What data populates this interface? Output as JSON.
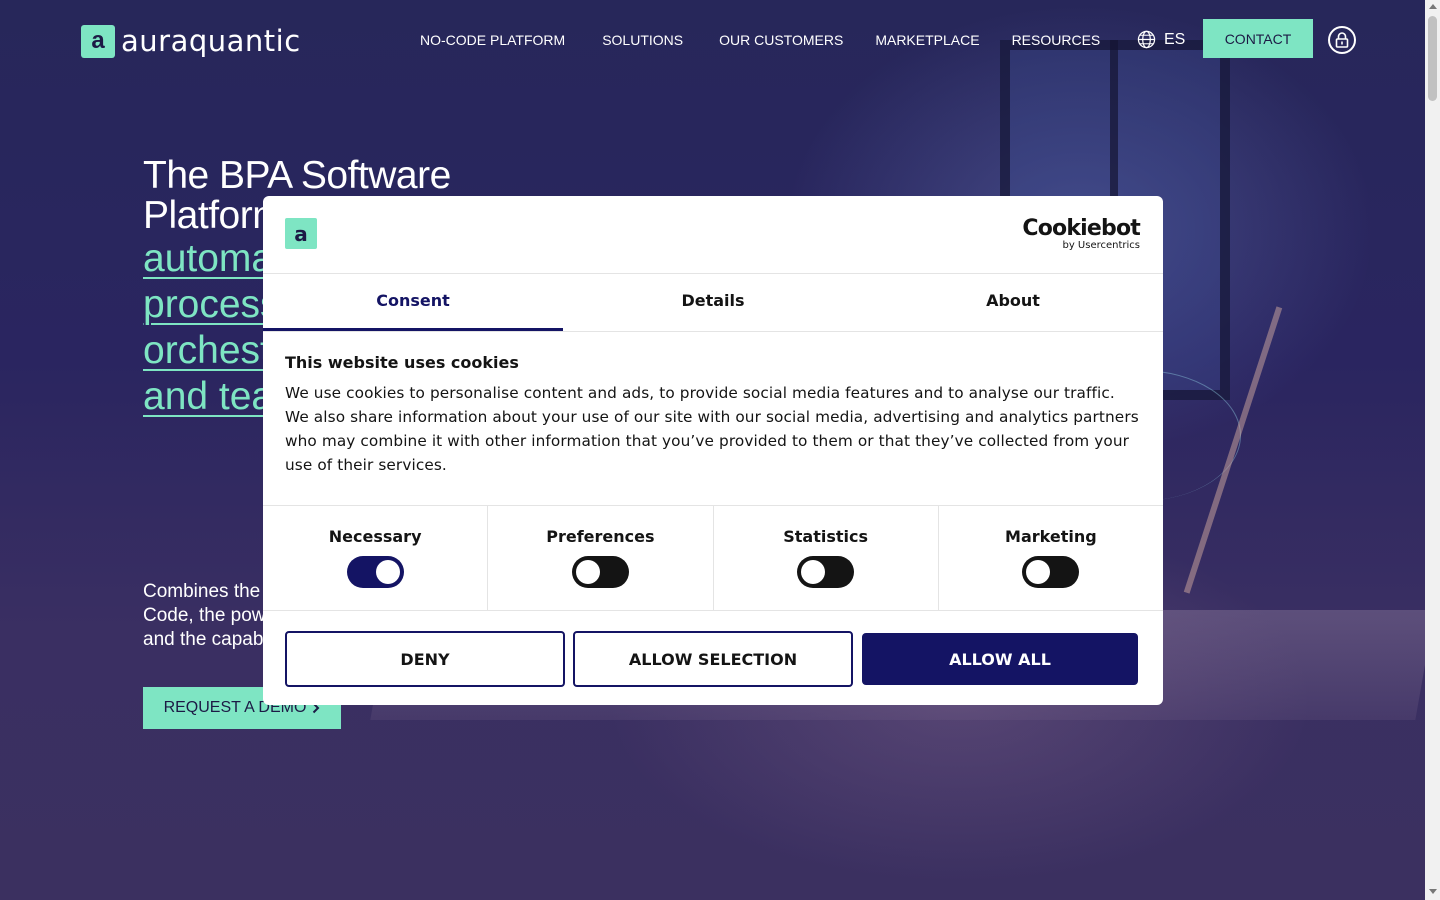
{
  "brand": {
    "mark": "a",
    "name": "auraquantic",
    "accent": "#7ee5c3",
    "dark": "#1c1a45"
  },
  "nav": {
    "items": [
      "NO-CODE PLATFORM",
      "SOLUTIONS",
      "OUR CUSTOMERS",
      "MARKETPLACE",
      "RESOURCES"
    ]
  },
  "header": {
    "language": "ES",
    "contact_label": "CONTACT",
    "globe_icon": "globe-icon",
    "lock_icon": "lock-icon"
  },
  "hero": {
    "title_lines": [
      "The BPA Software",
      "Platform"
    ],
    "accent_lines": [
      "automa",
      "process",
      "orchest",
      "and tea"
    ],
    "subtitle_lines": [
      "Combines the",
      "Code, the pow",
      "and the capab"
    ],
    "demo_label": "REQUEST A DEMO"
  },
  "cookie": {
    "logo_mark": "a",
    "provider": "Cookiebot",
    "provider_sub": "by Usercentrics",
    "tabs": [
      "Consent",
      "Details",
      "About"
    ],
    "active_tab": "Consent",
    "heading": "This website uses cookies",
    "body": "We use cookies to personalise content and ads, to provide social media features and to analyse our traffic. We also share information about your use of our site with our social media, advertising and analytics partners who may combine it with other information that you’ve provided to them or that they’ve collected from your use of their services.",
    "toggles": [
      {
        "label": "Necessary",
        "on": true
      },
      {
        "label": "Preferences",
        "on": false
      },
      {
        "label": "Statistics",
        "on": false
      },
      {
        "label": "Marketing",
        "on": false
      }
    ],
    "buttons": {
      "deny": "DENY",
      "selection": "ALLOW SELECTION",
      "all": "ALLOW ALL"
    },
    "primary_color": "#141464"
  }
}
